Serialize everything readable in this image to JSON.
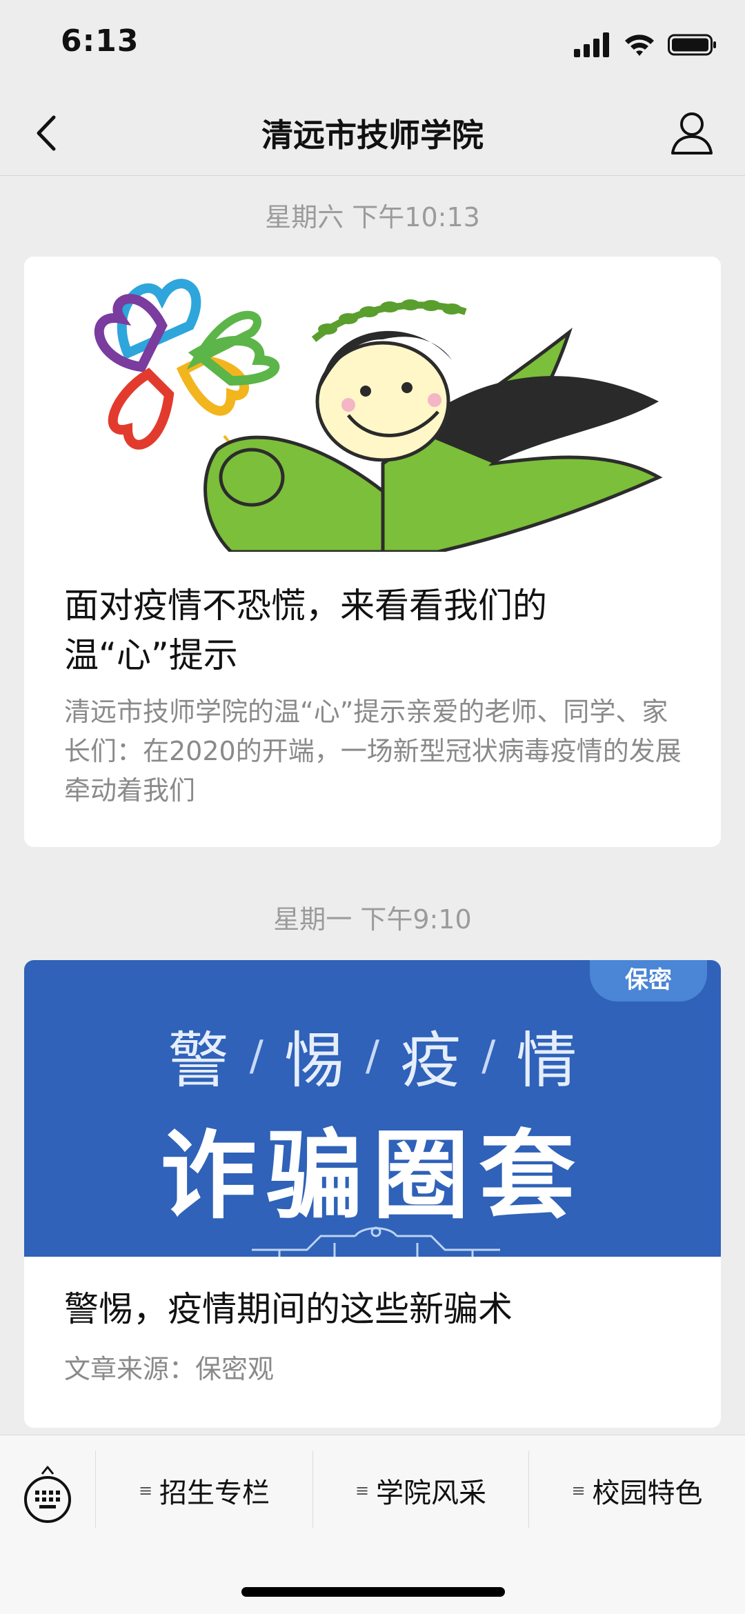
{
  "status_bar": {
    "time": "6:13"
  },
  "nav": {
    "title": "清远市技师学院"
  },
  "messages": [
    {
      "timestamp": "星期六 下午10:13",
      "title": "面对疫情不恐慌，来看看我们的温“心”提示",
      "description": "清远市技师学院的温“心”提示亲爱的老师、同学、家长们：在2020的开端，一场新型冠状病毒疫情的发展牵动着我们"
    },
    {
      "timestamp": "星期一 下午9:10",
      "banner": {
        "badge": "保密",
        "headline_small": [
          "警",
          "惕",
          "疫",
          "情"
        ],
        "headline_big": "诈骗圈套"
      },
      "title": "警惕，疫情期间的这些新骗术",
      "description": "文章来源：保密观"
    }
  ],
  "bottom_menu": [
    {
      "label": "招生专栏"
    },
    {
      "label": "学院风采"
    },
    {
      "label": "校园特色"
    }
  ],
  "colors": {
    "banner_blue": "#2f62b8",
    "mascot_green": "#7cbf3a",
    "timestamp_gray": "#9b9b9b"
  }
}
